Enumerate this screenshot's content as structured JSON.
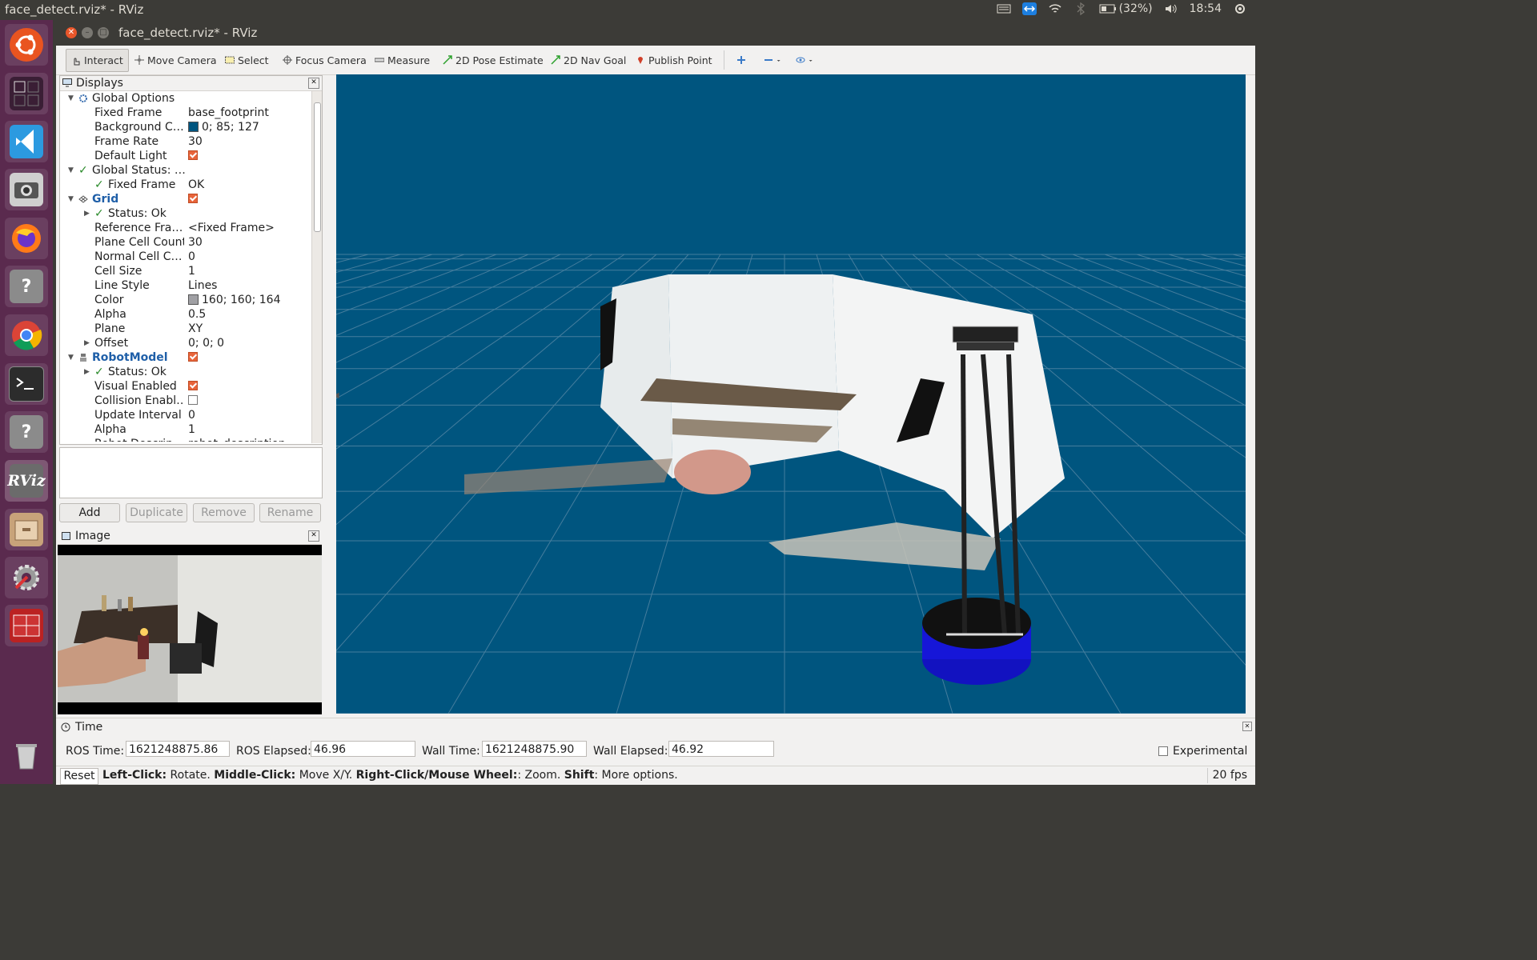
{
  "topbar": {
    "title": "face_detect.rviz* - RViz",
    "battery": "(32%)",
    "clock": "18:54"
  },
  "launcher": {
    "items": [
      "ubuntu-icon",
      "workspaces-icon",
      "vscode-icon",
      "screenshot-icon",
      "firefox-icon",
      "unknown-app-icon",
      "chrome-icon",
      "terminal-icon",
      "unknown-app-icon",
      "rviz-icon",
      "files-icon",
      "settings-icon",
      "system-monitor-icon",
      "trash-icon"
    ],
    "rviz_label": "RViz"
  },
  "window": {
    "title": "face_detect.rviz* - RViz"
  },
  "toolbar": {
    "interact": "Interact",
    "move_camera": "Move Camera",
    "select": "Select",
    "focus_camera": "Focus Camera",
    "measure": "Measure",
    "pose_estimate": "2D Pose Estimate",
    "nav_goal": "2D Nav Goal",
    "publish_point": "Publish Point"
  },
  "displays": {
    "title": "Displays",
    "rows": [
      {
        "key": "Global Options",
        "value": ""
      },
      {
        "key": "Fixed Frame",
        "value": "base_footprint"
      },
      {
        "key": "Background C…",
        "value": "0; 85; 127"
      },
      {
        "key": "Frame Rate",
        "value": "30"
      },
      {
        "key": "Default Light",
        "value": ""
      },
      {
        "key": "Global Status: …",
        "value": ""
      },
      {
        "key": "Fixed Frame",
        "value": "OK"
      },
      {
        "key": "Grid",
        "value": ""
      },
      {
        "key": "Status: Ok",
        "value": ""
      },
      {
        "key": "Reference Fra…",
        "value": "<Fixed Frame>"
      },
      {
        "key": "Plane Cell Count",
        "value": "30"
      },
      {
        "key": "Normal Cell C…",
        "value": "0"
      },
      {
        "key": "Cell Size",
        "value": "1"
      },
      {
        "key": "Line Style",
        "value": "Lines"
      },
      {
        "key": "Color",
        "value": "160; 160; 164"
      },
      {
        "key": "Alpha",
        "value": "0.5"
      },
      {
        "key": "Plane",
        "value": "XY"
      },
      {
        "key": "Offset",
        "value": "0; 0; 0"
      },
      {
        "key": "RobotModel",
        "value": ""
      },
      {
        "key": "Status: Ok",
        "value": ""
      },
      {
        "key": "Visual Enabled",
        "value": ""
      },
      {
        "key": "Collision Enabl…",
        "value": ""
      },
      {
        "key": "Update Interval",
        "value": "0"
      },
      {
        "key": "Alpha",
        "value": "1"
      },
      {
        "key": "Robot Descrip…",
        "value": "robot_description"
      }
    ],
    "buttons": {
      "add": "Add",
      "duplicate": "Duplicate",
      "remove": "Remove",
      "rename": "Rename"
    }
  },
  "colors": {
    "background": "#00557f",
    "grid_color": "#a0a0a4"
  },
  "image_panel": {
    "title": "Image"
  },
  "time": {
    "title": "Time",
    "ros_time_label": "ROS Time:",
    "ros_time": "1621248875.86",
    "ros_elapsed_label": "ROS Elapsed:",
    "ros_elapsed": "46.96",
    "wall_time_label": "Wall Time:",
    "wall_time": "1621248875.90",
    "wall_elapsed_label": "Wall Elapsed:",
    "wall_elapsed": "46.92",
    "experimental": "Experimental"
  },
  "status": {
    "reset": "Reset",
    "left_click": "Left-Click:",
    "left_click_action": " Rotate. ",
    "middle_click": "Middle-Click:",
    "middle_click_action": " Move X/Y. ",
    "right_click": "Right-Click/Mouse Wheel:",
    "right_click_action": ": Zoom. ",
    "shift": "Shift",
    "shift_action": ": More options.",
    "fps": "20 fps"
  }
}
